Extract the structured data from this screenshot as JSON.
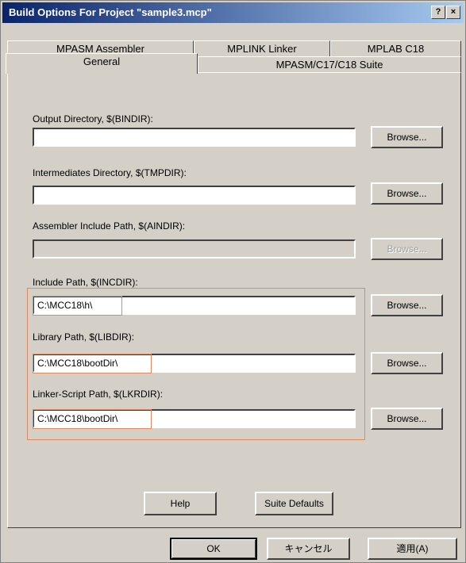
{
  "window": {
    "title": "Build Options For Project \"sample3.mcp\"",
    "help_glyph": "?",
    "close_glyph": "×"
  },
  "tabs": {
    "row1": [
      "MPASM Assembler",
      "MPLINK Linker",
      "MPLAB C18"
    ],
    "row2": [
      "General",
      "MPASM/C17/C18 Suite"
    ],
    "active": "General"
  },
  "fields": [
    {
      "label": "Output Directory, $(BINDIR):",
      "value": "",
      "browse": "Browse...",
      "enabled": true
    },
    {
      "label": "Intermediates Directory, $(TMPDIR):",
      "value": "",
      "browse": "Browse...",
      "enabled": true
    },
    {
      "label": "Assembler Include Path, $(AINDIR):",
      "value": "",
      "browse": "Browse...",
      "enabled": false
    },
    {
      "label": "Include Path, $(INCDIR):",
      "value": "C:\\MCC18\\h\\",
      "browse": "Browse...",
      "enabled": true
    },
    {
      "label": "Library Path, $(LIBDIR):",
      "value": "C:\\MCC18\\bootDir\\",
      "browse": "Browse...",
      "enabled": true
    },
    {
      "label": "Linker-Script Path, $(LKRDIR):",
      "value": "C:\\MCC18\\bootDir\\",
      "browse": "Browse...",
      "enabled": true
    }
  ],
  "panel_buttons": {
    "help": "Help",
    "suite_defaults": "Suite Defaults"
  },
  "dialog_buttons": {
    "ok": "OK",
    "cancel": "キャンセル",
    "apply": "適用(A)"
  },
  "highlight_color": "#e08a64"
}
